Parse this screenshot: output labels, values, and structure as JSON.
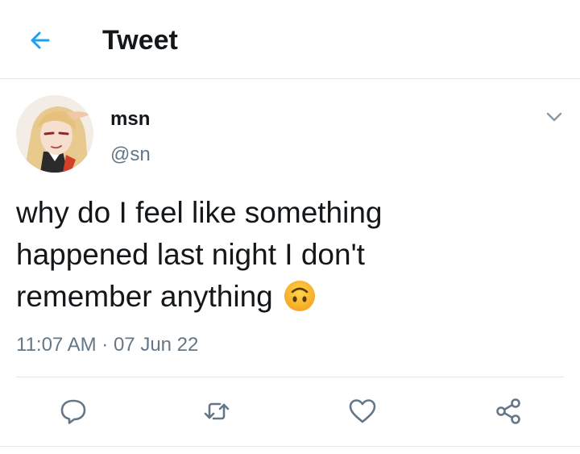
{
  "header": {
    "title": "Tweet",
    "back_icon": "arrow-left-icon"
  },
  "user": {
    "display_name": "msn",
    "handle": "@sn",
    "avatar": "anime-character-avatar"
  },
  "tweet": {
    "lines": [
      "why do I feel like something",
      "happened last night I don't",
      "remember anything"
    ],
    "emoji": "upside-down-face-emoji",
    "timestamp": "11:07 AM · 07 Jun 22"
  },
  "actions": [
    {
      "name": "reply",
      "icon": "reply-icon"
    },
    {
      "name": "retweet",
      "icon": "retweet-icon"
    },
    {
      "name": "like",
      "icon": "heart-icon"
    },
    {
      "name": "share",
      "icon": "share-icon"
    }
  ],
  "colors": {
    "accent": "#1da1f2",
    "text": "#14171a",
    "secondary_text": "#657786",
    "icon": "#657786",
    "divider": "#e1e8ed"
  }
}
